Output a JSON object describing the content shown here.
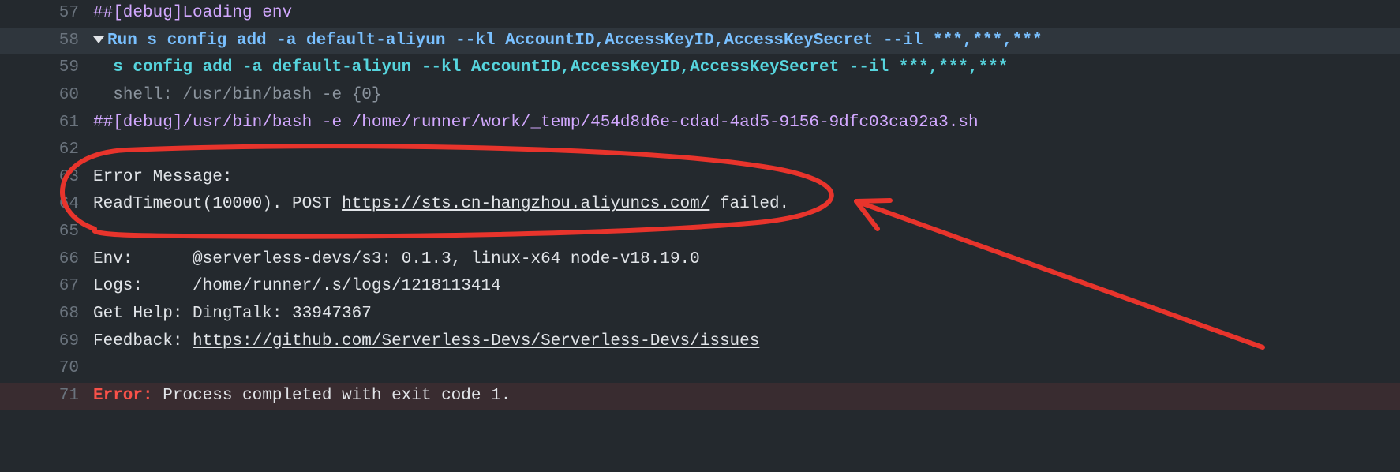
{
  "lines": {
    "57": {
      "num": "57",
      "debug_tag": "##[debug]",
      "text": "Loading env"
    },
    "58": {
      "num": "58",
      "prefix": "Run ",
      "cmd": "s config add -a default-aliyun --kl AccountID,AccessKeyID,AccessKeySecret --il ***,***,***"
    },
    "59": {
      "num": "59",
      "indent": "  ",
      "cmd": "s config add -a default-aliyun --kl AccountID,AccessKeyID,AccessKeySecret --il ***,***,***"
    },
    "60": {
      "num": "60",
      "indent": "  ",
      "text": "shell: /usr/bin/bash -e {0}"
    },
    "61": {
      "num": "61",
      "debug_tag": "##[debug]",
      "text": "/usr/bin/bash -e /home/runner/work/_temp/454d8d6e-cdad-4ad5-9156-9dfc03ca92a3.sh"
    },
    "62": {
      "num": "62"
    },
    "63": {
      "num": "63",
      "text": "Error Message:"
    },
    "64": {
      "num": "64",
      "pre": "ReadTimeout(10000). POST ",
      "url": "https://sts.cn-hangzhou.aliyuncs.com/",
      "post": " failed."
    },
    "65": {
      "num": "65"
    },
    "66": {
      "num": "66",
      "label": "Env:",
      "pad": "      ",
      "value": "@serverless-devs/s3: 0.1.3, linux-x64 node-v18.19.0"
    },
    "67": {
      "num": "67",
      "label": "Logs:",
      "pad": "     ",
      "value": "/home/runner/.s/logs/1218113414"
    },
    "68": {
      "num": "68",
      "label": "Get Help:",
      "pad": " ",
      "value": "DingTalk: 33947367"
    },
    "69": {
      "num": "69",
      "label": "Feedback:",
      "pad": " ",
      "url": "https://github.com/Serverless-Devs/Serverless-Devs/issues"
    },
    "70": {
      "num": "70"
    },
    "71": {
      "num": "71",
      "err": "Error:",
      "text": " Process completed with exit code 1."
    }
  },
  "annotation": {
    "color": "#e8342c"
  }
}
